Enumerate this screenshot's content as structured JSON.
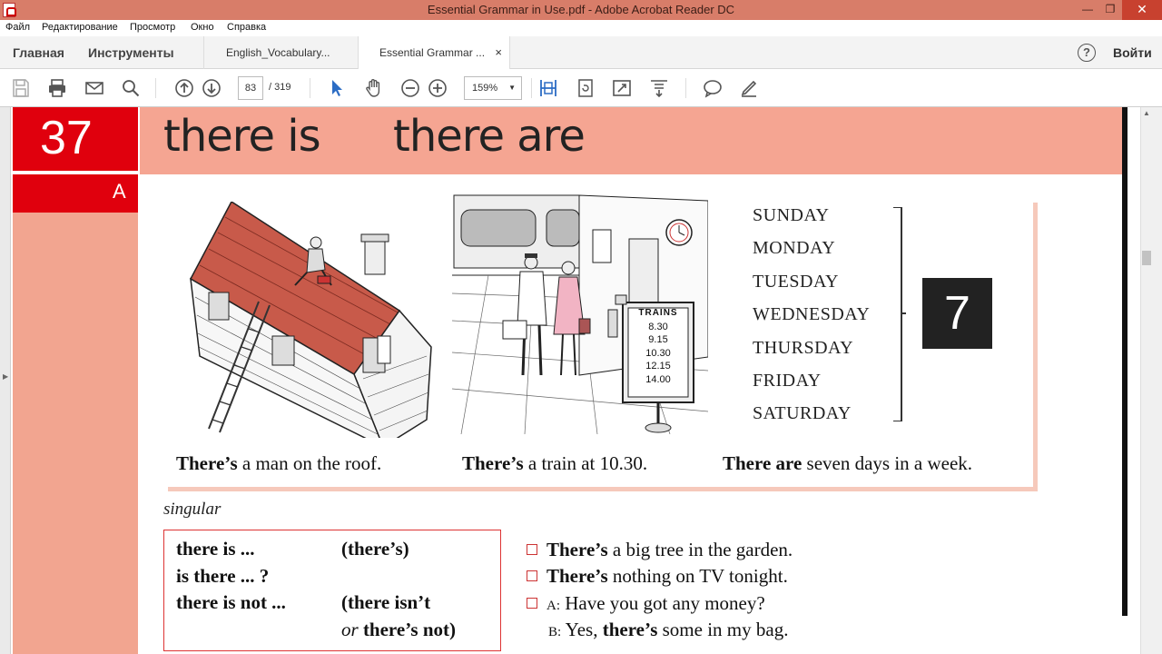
{
  "window": {
    "title": "Essential Grammar in Use.pdf - Adobe Acrobat Reader DC",
    "min_glyph": "—",
    "max_glyph": "❐",
    "close_glyph": "✕"
  },
  "menu": [
    "Файл",
    "Редактирование",
    "Просмотр",
    "Окно",
    "Справка"
  ],
  "tabs": {
    "home": "Главная",
    "tools": "Инструменты",
    "doc1": "English_Vocabulary...",
    "doc2": "Essential Grammar ...",
    "close_glyph": "×",
    "help": "?",
    "signin": "Войти"
  },
  "toolbar": {
    "icons": [
      "save-icon",
      "print-icon",
      "email-icon",
      "search-icon",
      "page-up-icon",
      "page-down-icon",
      "select-arrow-icon",
      "hand-icon",
      "zoom-out-icon",
      "zoom-in-icon",
      "fit-page-icon",
      "rotate-icon",
      "fullscreen-icon",
      "read-mode-icon",
      "comment-icon",
      "highlight-icon"
    ],
    "page_current": "83",
    "page_total": "/ 319",
    "zoom": "159%"
  },
  "page": {
    "unit_number": "37",
    "section_letter": "A",
    "heading_left": "there is",
    "heading_right": "there are",
    "captions": [
      {
        "bold": "There’s",
        "rest": " a man on the roof."
      },
      {
        "bold": "There’s",
        "rest": " a train at 10.30."
      },
      {
        "bold": "There are",
        "rest": " seven days in a week."
      }
    ],
    "days": [
      "SUNDAY",
      "MONDAY",
      "TUESDAY",
      "WEDNESDAY",
      "THURSDAY",
      "FRIDAY",
      "SATURDAY"
    ],
    "days_count": "7",
    "train_board": {
      "title": "TRAINS",
      "times": [
        "8.30",
        "9.15",
        "10.30",
        "12.15",
        "14.00"
      ]
    },
    "subhead": "singular",
    "grammar": [
      {
        "form": "there is ...",
        "short": "(there’s)"
      },
      {
        "form": "is there ... ?",
        "short": ""
      },
      {
        "form": "there is not ...",
        "short": "(there isn’t"
      },
      {
        "form": "",
        "short_prefix": "or",
        "short": "there’s not)"
      }
    ],
    "examples": [
      {
        "bold": "There’s",
        "rest": " a big tree in the garden."
      },
      {
        "bold": "There’s",
        "rest": " nothing on TV tonight."
      },
      {
        "speaker": "A:",
        "rest": " Have you got any money?"
      },
      {
        "speaker": "B:",
        "pre": " Yes, ",
        "bold": "there’s",
        "rest": " some in my bag."
      }
    ]
  },
  "colors": {
    "titlebar": "#d87d69",
    "unit_red": "#e0000d",
    "header_salmon": "#f5a592"
  }
}
